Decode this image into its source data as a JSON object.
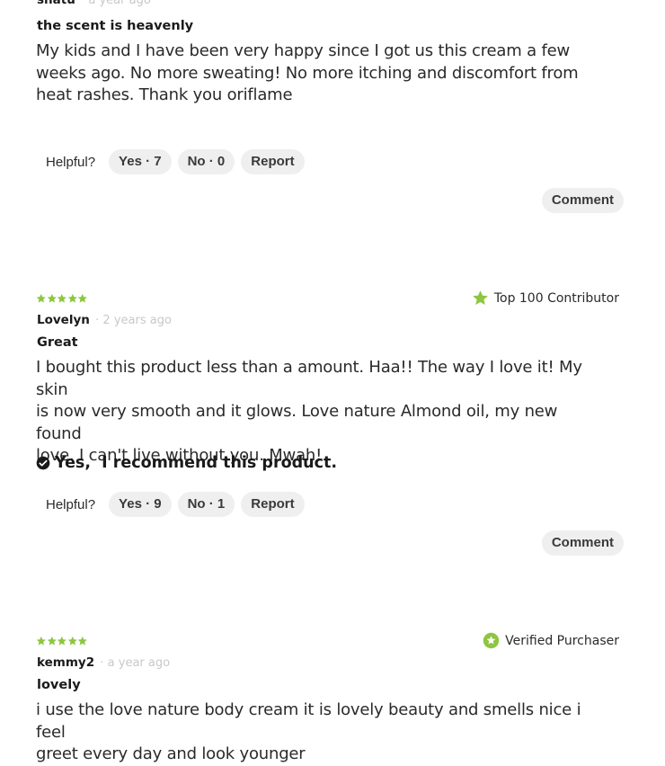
{
  "colors": {
    "star_green": "#8dc63f",
    "pill_bg": "#efefef",
    "muted_time": "#c8c8c8"
  },
  "reviews": [
    {
      "author": "shatu",
      "time": "· a year ago",
      "title": "the scent is heavenly",
      "body_lines": [
        "My kids and I have been very happy since I got us this cream a few",
        "weeks ago. No more sweating! No more itching and discomfort from",
        "heat rashes. Thank you oriflame"
      ],
      "helpful_label": "Helpful?",
      "yes_label": "Yes · 7",
      "no_label": "No · 0",
      "report_label": "Report",
      "comment_label": "Comment"
    },
    {
      "rating": 5,
      "badge_label": "Top 100 Contributor",
      "badge_icon": "star-icon",
      "author": "Lovelyn",
      "time": "· 2 years ago",
      "title": "Great",
      "body_lines": [
        "I bought this product less than a amount. Haa!! The way I love it! My skin",
        "is now very smooth and it glows. Love nature Almond oil, my new found",
        "love. I can't live without you. Mwah!"
      ],
      "recommend_label": "Yes,  I recommend this product.",
      "helpful_label": "Helpful?",
      "yes_label": "Yes · 9",
      "no_label": "No · 1",
      "report_label": "Report",
      "comment_label": "Comment"
    },
    {
      "rating": 5,
      "badge_label": "Verified Purchaser",
      "badge_icon": "verified-check-icon",
      "author": "kemmy2",
      "time": "· a year ago",
      "title": "lovely",
      "body_lines": [
        "i use the love nature body cream it is lovely beauty and smells nice i feel",
        "greet every day and look younger"
      ]
    }
  ]
}
